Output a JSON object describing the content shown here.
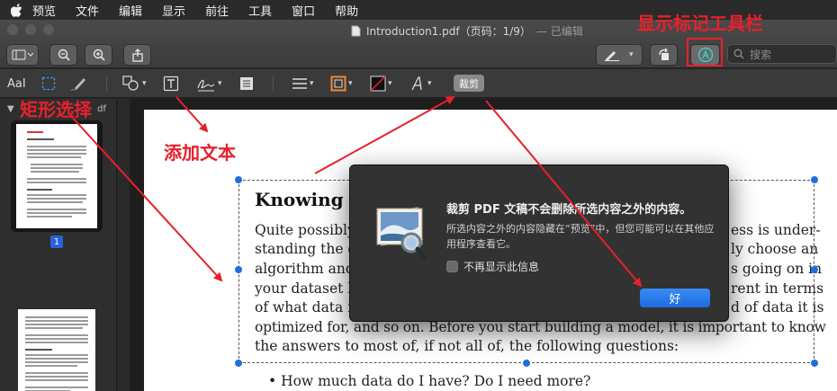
{
  "menubar": {
    "items": [
      "预览",
      "文件",
      "编辑",
      "显示",
      "前往",
      "工具",
      "窗口",
      "帮助"
    ]
  },
  "window": {
    "title": "Introduction1.pdf（页码：1/9）",
    "edited": "— 已编辑",
    "search_placeholder": "搜索"
  },
  "markup": {
    "text_style_label": "AaI",
    "crop_label": "裁剪"
  },
  "sidebar": {
    "filename_tail": "df",
    "current_page": "1"
  },
  "document": {
    "heading": "Knowing yo",
    "lines": [
      "Quite possibly",
      "standing the d",
      "algorithm and",
      "your dataset b",
      "of what data i",
      "optimized for, and so on. Before you start building a model, it is important to know",
      "the answers to most of, if not all of, the following questions:"
    ],
    "right_fragments": [
      "ess is under-",
      "ly choose an",
      "s going on in",
      "rent in terms",
      "d of data it is"
    ],
    "bullet": "•  How much data do I have? Do I need more?"
  },
  "dialog": {
    "title": "裁剪 PDF 文稿不会删除所选内容之外的内容。",
    "message": "所选内容之外的内容隐藏在“预览”中，但您可能可以在其他应用程序查看它。",
    "checkbox_label": "不再显示此信息",
    "ok_label": "好"
  },
  "annotations": {
    "show_markup": "显示标记工具栏",
    "rect_select": "矩形选择",
    "add_text": "添加文本"
  },
  "colors": {
    "accent": "#1f6fe0",
    "annotation": "#e8202a",
    "markup_teal": "#3fd0c9"
  }
}
